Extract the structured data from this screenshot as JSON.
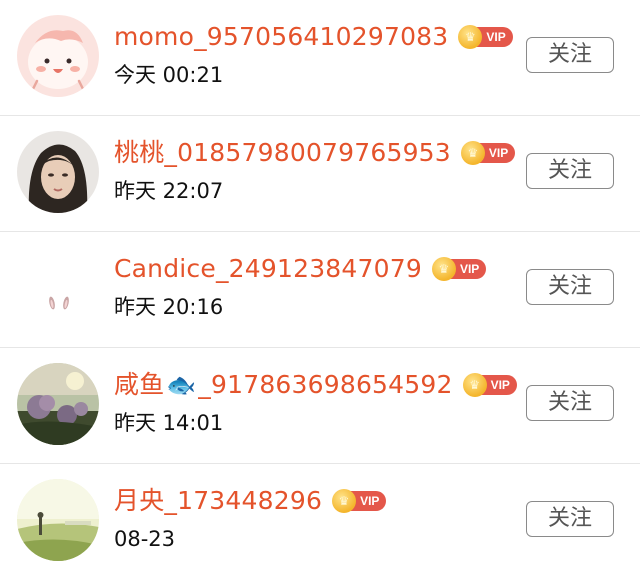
{
  "users": [
    {
      "name": "momo_957056410297083",
      "time": "今天 00:21",
      "vip": "VIP",
      "follow": "关注",
      "avatar": "pink-cartoon-avatar"
    },
    {
      "name": "桃桃_01857980079765953",
      "time": "昨天 22:07",
      "vip": "VIP",
      "follow": "关注",
      "avatar": "portrait-avatar"
    },
    {
      "name": "Candice_249123847079",
      "time": "昨天 20:16",
      "vip": "VIP",
      "follow": "关注",
      "avatar": "bunny-ears-avatar"
    },
    {
      "name_prefix": "咸鱼",
      "name_emoji": "🐟",
      "name_suffix": "_917863698654592",
      "time": "昨天 14:01",
      "vip": "VIP",
      "follow": "关注",
      "avatar": "flowers-avatar"
    },
    {
      "name": "月央_173448296",
      "time": "08-23",
      "vip": "VIP",
      "follow": "关注",
      "avatar": "landscape-avatar"
    }
  ],
  "colors": {
    "name": "#e4532b",
    "vip_tag": "#e4574a",
    "crown": "#f4b52b",
    "divider": "#e6e6e6"
  }
}
